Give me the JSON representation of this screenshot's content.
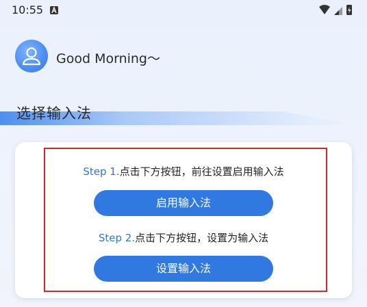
{
  "status": {
    "time": "10:55"
  },
  "header": {
    "greeting": "Good Morning～"
  },
  "section": {
    "title": "选择输入法"
  },
  "steps": [
    {
      "num": "Step 1.",
      "text": "点击下方按钮，前往设置启用输入法",
      "button": "启用输入法"
    },
    {
      "num": "Step 2.",
      "text": "点击下方按钮，设置为输入法",
      "button": "设置输入法"
    }
  ],
  "colors": {
    "accent": "#2f79e0",
    "highlight": "#d6232b"
  }
}
